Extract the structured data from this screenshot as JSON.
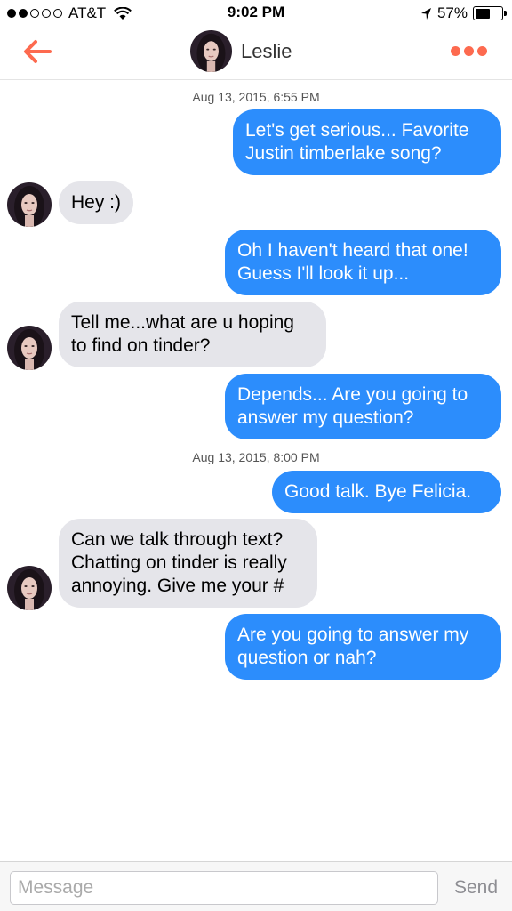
{
  "status_bar": {
    "signal_bars_filled": 2,
    "signal_bars_total": 5,
    "carrier": "AT&T",
    "time": "9:02 PM",
    "battery_percent_label": "57%",
    "battery_level": 0.57,
    "icons": [
      "wifi-icon",
      "location-arrow-icon",
      "battery-icon"
    ]
  },
  "header": {
    "contact_name": "Leslie",
    "back_icon": "back-arrow-icon",
    "more_icon": "more-dots-icon",
    "accent_color": "#fd6a4f"
  },
  "conversation": {
    "timestamps": [
      "Aug 13, 2015, 6:55 PM",
      "Aug 13, 2015, 8:00 PM"
    ],
    "messages": [
      {
        "from": "me",
        "text": "Let's get serious... Favorite\nJustin timberlake song?"
      },
      {
        "from": "Leslie",
        "text": "Hey :)"
      },
      {
        "from": "me",
        "text": "Oh I haven't heard that one!\nGuess I'll look it up..."
      },
      {
        "from": "Leslie",
        "text": "Tell me...what are u hoping\nto find on tinder?"
      },
      {
        "from": "me",
        "text": "Depends... Are you going to\nanswer my question?"
      },
      {
        "from": "me",
        "text": "Good talk. Bye Felicia."
      },
      {
        "from": "Leslie",
        "text": "Can we talk through text?\nChatting on tinder is really\nannoying. Give me your #"
      },
      {
        "from": "me",
        "text": "Are you going to answer my\nquestion or nah?"
      }
    ],
    "colors": {
      "outgoing": "#2c8dfc",
      "incoming": "#e5e5ea"
    }
  },
  "composer": {
    "placeholder": "Message",
    "value": "",
    "send_label": "Send"
  }
}
